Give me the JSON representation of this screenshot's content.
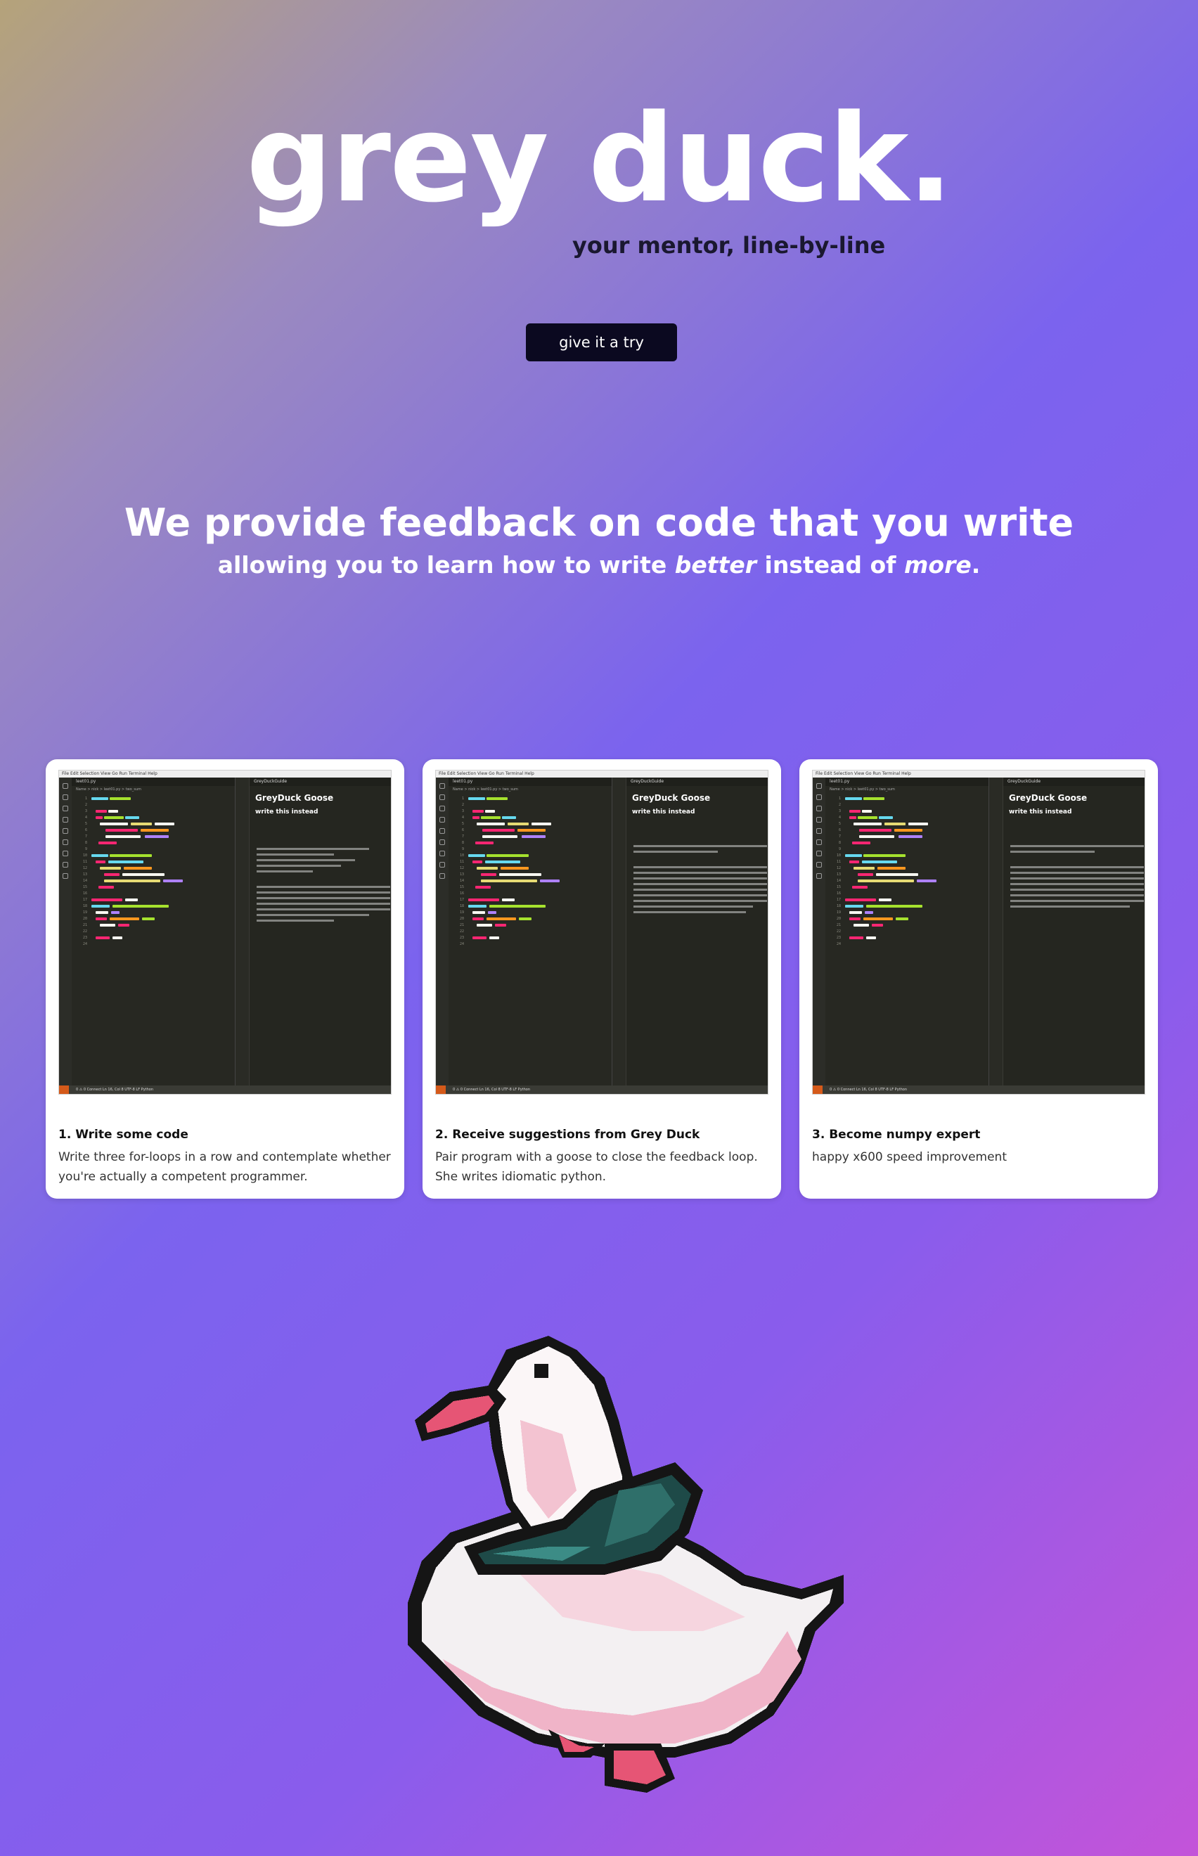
{
  "hero": {
    "title": "grey duck.",
    "subtitle": "your mentor, line-by-line",
    "cta_label": "give it a try"
  },
  "feedback": {
    "title": "We provide feedback on code that you write",
    "sub_part1": "allowing you to learn how to write ",
    "sub_em1": "better",
    "sub_part2": " instead of ",
    "sub_em2": "more",
    "sub_part3": "."
  },
  "screenshot": {
    "menu": "File  Edit  Selection  View  Go  Run  Terminal  Help",
    "editor_tab": "leet01.py",
    "breadcrumb": "Name > nick > leet01.py > two_sum",
    "panel_tab": "GreyDuckGuide",
    "panel_title": "GreyDuck Goose",
    "panel_subtitle": "write this instead",
    "status_text": "0 ⚠ 0   Connect            Ln 16, Col 8   UTF-8   LF   Python"
  },
  "cards": [
    {
      "title": "1. Write some code",
      "description": "Write three for-loops in a row and contemplate whether you're actually a competent programmer."
    },
    {
      "title": "2. Receive suggestions from Grey Duck",
      "description": "Pair program with a goose to close the feedback loop. She writes idiomatic python."
    },
    {
      "title": "3. Become numpy expert",
      "description": "happy x600 speed improvement"
    }
  ],
  "colors": {
    "cta_bg": "#0b0920",
    "subtitle_text": "#1a1830",
    "duck_pink": "#f0b4c8",
    "duck_beak": "#e65575",
    "duck_scarf": "#1e4a48"
  },
  "icons": {
    "mascot": "pixel-goose-icon"
  }
}
